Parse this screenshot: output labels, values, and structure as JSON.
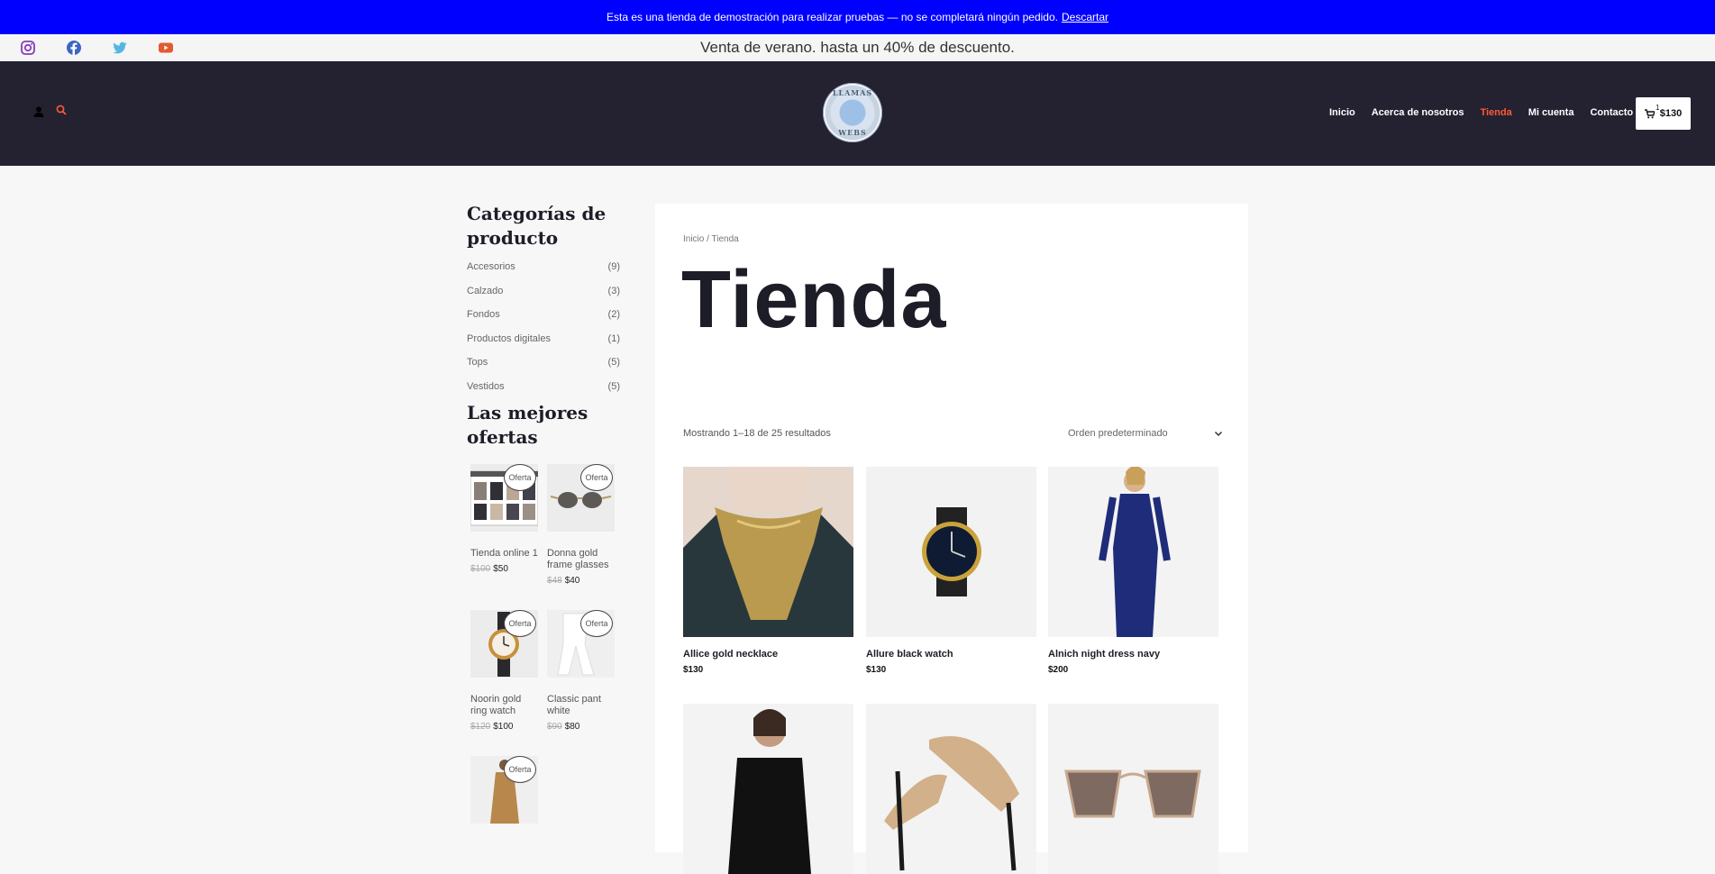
{
  "notice": {
    "text": "Esta es una tienda de demostración para realizar pruebas — no se completará ningún pedido.",
    "dismiss": "Descartar"
  },
  "topbar": {
    "promo": "Venta de verano. hasta un 40% de descuento.",
    "social": [
      "instagram-icon",
      "facebook-icon",
      "twitter-icon",
      "youtube-icon"
    ]
  },
  "header": {
    "logo_top": "LLAMAS",
    "logo_bottom": "WEBS",
    "nav": [
      {
        "label": "Inicio",
        "active": false
      },
      {
        "label": "Acerca de nosotros",
        "active": false
      },
      {
        "label": "Tienda",
        "active": true
      },
      {
        "label": "Mi cuenta",
        "active": false
      },
      {
        "label": "Contacto",
        "active": false
      }
    ],
    "cart": {
      "count": "1",
      "total": "$130"
    },
    "accent": "#ff5a35",
    "background": "#242131"
  },
  "sidebar": {
    "categories_title": "Categorías de producto",
    "categories": [
      {
        "label": "Accesorios",
        "count": "(9)"
      },
      {
        "label": "Calzado",
        "count": "(3)"
      },
      {
        "label": "Fondos",
        "count": "(2)"
      },
      {
        "label": "Productos digitales",
        "count": "(1)"
      },
      {
        "label": "Tops",
        "count": "(5)"
      },
      {
        "label": "Vestidos",
        "count": "(5)"
      }
    ],
    "deals_title": "Las mejores ofertas",
    "badge": "Oferta",
    "deals": [
      {
        "name": "Tienda online 1",
        "old": "$100",
        "price": "$50"
      },
      {
        "name": "Donna gold frame glasses",
        "old": "$48",
        "price": "$40"
      },
      {
        "name": "Noorin gold ring watch",
        "old": "$120",
        "price": "$100"
      },
      {
        "name": "Classic pant white",
        "old": "$90",
        "price": "$80"
      },
      {
        "name": "",
        "old": "",
        "price": ""
      }
    ]
  },
  "main": {
    "breadcrumb": "Inicio / Tienda",
    "title": "Tienda",
    "result_count": "Mostrando 1–18 de 25 resultados",
    "ordering": "Orden predeterminado",
    "products": [
      {
        "name": "Allice gold necklace",
        "price": "$130"
      },
      {
        "name": "Allure black watch",
        "price": "$130"
      },
      {
        "name": "Alnich night dress navy",
        "price": "$200"
      },
      {
        "name": "",
        "price": ""
      },
      {
        "name": "",
        "price": ""
      },
      {
        "name": "",
        "price": ""
      }
    ]
  }
}
